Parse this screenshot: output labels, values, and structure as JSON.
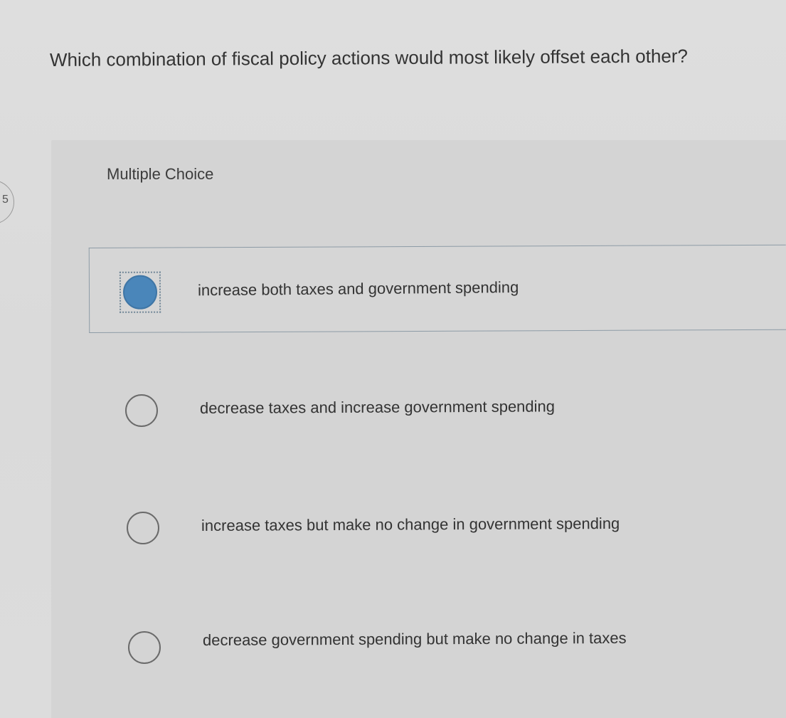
{
  "question": {
    "text": "Which combination of fiscal policy actions would most likely offset each other?"
  },
  "panel": {
    "label": "Multiple Choice"
  },
  "side_tab": {
    "label": "5"
  },
  "options": [
    {
      "label": "increase both taxes and government spending",
      "selected": true
    },
    {
      "label": "decrease taxes and increase government spending",
      "selected": false
    },
    {
      "label": "increase taxes but make no change in government spending",
      "selected": false
    },
    {
      "label": "decrease government spending but make no change in taxes",
      "selected": false
    }
  ],
  "colors": {
    "selected_radio": "#4a86ba",
    "selected_border": "#8d9ba6",
    "background": "#dcdcdc"
  },
  "icons": {
    "radio_selected": "radio-filled-icon",
    "radio_unselected": "radio-empty-icon"
  }
}
